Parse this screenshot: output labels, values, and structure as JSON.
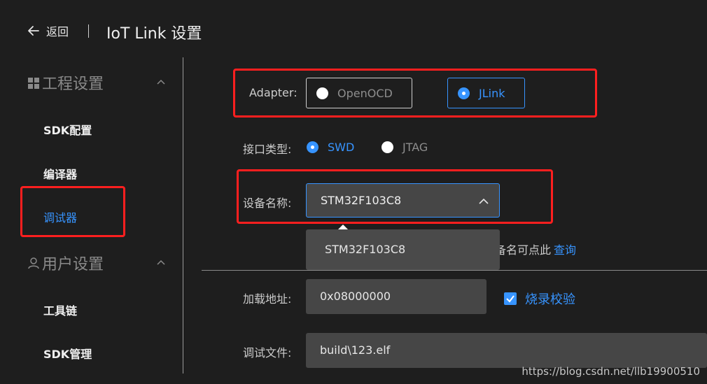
{
  "header": {
    "back_label": "返回",
    "title": "IoT Link 设置"
  },
  "sidebar": {
    "groups": [
      {
        "label": "工程设置",
        "icon": "grid-icon",
        "items": [
          {
            "label": "SDK配置"
          },
          {
            "label": "编译器"
          },
          {
            "label": "调试器",
            "active": true
          }
        ]
      },
      {
        "label": "用户设置",
        "icon": "user-icon",
        "items": [
          {
            "label": "工具链"
          },
          {
            "label": "SDK管理"
          }
        ]
      }
    ]
  },
  "form": {
    "adapter": {
      "label": "Adapter:",
      "options": [
        {
          "label": "OpenOCD",
          "selected": false
        },
        {
          "label": "JLink",
          "selected": true
        }
      ]
    },
    "interface": {
      "label": "接口类型:",
      "options": [
        {
          "label": "SWD",
          "selected": true
        },
        {
          "label": "JTAG",
          "selected": false
        }
      ]
    },
    "device": {
      "label": "设备名称:",
      "value": "STM32F103C8",
      "dropdown_options": [
        "STM32F103C8"
      ],
      "hint": "备名可点此",
      "hint_link": "查询"
    },
    "load_address": {
      "label": "加载地址:",
      "value": "0x08000000"
    },
    "verify": {
      "label": "烧录校验",
      "checked": true
    },
    "debug_file": {
      "label": "调试文件:",
      "value": "build\\123.elf"
    }
  },
  "watermark": "https://blog.csdn.net/llb19900510",
  "colors": {
    "accent": "#3794ff",
    "annotation": "#ff1f1f",
    "background": "#1e1e1e"
  }
}
